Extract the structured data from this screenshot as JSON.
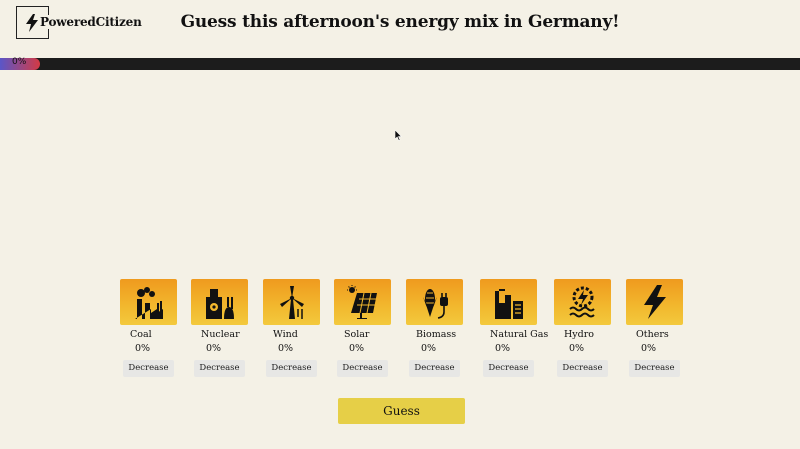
{
  "brand": {
    "name": "PoweredCitizen",
    "logo_icon": "lightning-bolt-icon"
  },
  "header": {
    "title": "Guess this afternoon's energy mix in Germany!"
  },
  "progress": {
    "label": "0%",
    "value_percent": 0,
    "fill_color": "#d43a44"
  },
  "sources": [
    {
      "name": "Coal",
      "percent": "0%",
      "icon": "coal-plant-icon",
      "button": "Decrease"
    },
    {
      "name": "Nuclear",
      "percent": "0%",
      "icon": "nuclear-plant-icon",
      "button": "Decrease"
    },
    {
      "name": "Wind",
      "percent": "0%",
      "icon": "wind-turbine-icon",
      "button": "Decrease"
    },
    {
      "name": "Solar",
      "percent": "0%",
      "icon": "solar-panel-icon",
      "button": "Decrease"
    },
    {
      "name": "Biomass",
      "percent": "0%",
      "icon": "biomass-corn-icon",
      "button": "Decrease"
    },
    {
      "name": "Natural Gas",
      "percent": "0%",
      "icon": "gas-plant-icon",
      "button": "Decrease"
    },
    {
      "name": "Hydro",
      "percent": "0%",
      "icon": "hydro-wave-icon",
      "button": "Decrease"
    },
    {
      "name": "Others",
      "percent": "0%",
      "icon": "lightning-bolt-icon",
      "button": "Decrease"
    }
  ],
  "actions": {
    "guess_label": "Guess"
  },
  "colors": {
    "background": "#f4f1e6",
    "tile": "#f2b82e",
    "guess_button": "#e6cf47",
    "progress_track": "#1c1c1c"
  }
}
